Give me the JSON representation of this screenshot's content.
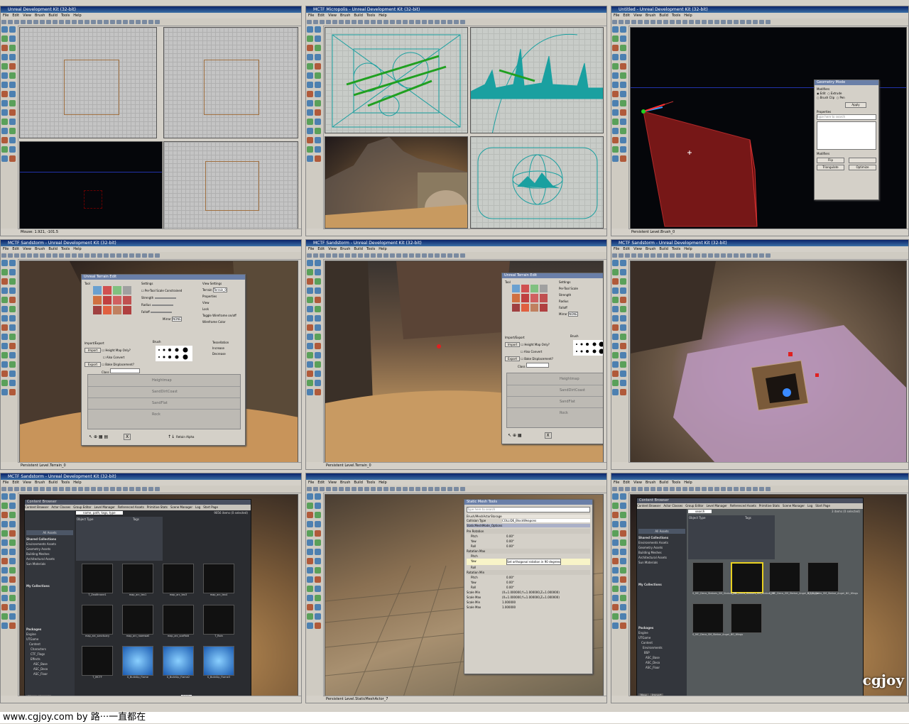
{
  "panels": [
    {
      "title": "Unreal Development Kit (32-bit)",
      "status": "Mouse: 1.921, -101.5"
    },
    {
      "title": "MCTF Micropolis - Unreal Development Kit (32-bit)",
      "status": ""
    },
    {
      "title": "Untitled - Unreal Development Kit (32-bit)",
      "status": "Persistent Level.Brush_0"
    },
    {
      "title": "MCTF Sandstorm - Unreal Development Kit (32-bit)",
      "status": "Persistent Level.Terrain_0"
    },
    {
      "title": "MCTF Sandstorm - Unreal Development Kit (32-bit)",
      "status": "Persistent Level.Terrain_0"
    },
    {
      "title": "MCTF Sandstorm - Unreal Development Kit (32-bit)",
      "status": ""
    },
    {
      "title": "MCTF Sandstorm - Unreal Development Kit (32-bit)",
      "status": ""
    },
    {
      "title": "",
      "status": "Persistent Level.StaticMeshActor_7"
    },
    {
      "title": "",
      "status": ""
    }
  ],
  "menu": [
    "File",
    "Edit",
    "View",
    "Brush",
    "Build",
    "Tools",
    "Help"
  ],
  "terrain_dialog": {
    "title": "Unreal Terrain Edit",
    "tool_label": "Tool",
    "settings_label": "Settings",
    "per_tool_scale": "Per-Tool Scale",
    "constrained": "Constrained",
    "strength": "Strength",
    "radius": "Radius",
    "falloff": "Falloff",
    "mirror": "Mirror",
    "mirror_value": "NONE",
    "view_settings": "View Settings",
    "terrain": "Terrain",
    "terrain_value": "Terrain_0",
    "properties": "Properties",
    "view": "View",
    "lock": "Lock",
    "toggle_wireframe": "Toggle Wireframe on/off",
    "wireframe_color": "Wireframe Color",
    "import_export": "Import/Export",
    "import_btn": "Import",
    "export_btn": "Export",
    "heightmap_only": "Height Map Only?",
    "retain_current": "Also Convert",
    "bake_displacement": "Bake Displacement?",
    "class_label": "Class",
    "brush_label": "Brush",
    "tessellation": "Tessellation",
    "increase": "Increase",
    "decrease": "Decrease",
    "layers": [
      "Heightmap",
      "SandDirtCoast",
      "SandFlat",
      "Rock"
    ],
    "retain_alpha": "Retain Alpha",
    "close_btn": "X"
  },
  "geometry_dialog": {
    "title": "Geometry Mode",
    "modifiers": "Modifiers",
    "edit": "Edit",
    "extrude": "Extrude",
    "brush_clip": "Brush Clip",
    "pen": "Pen",
    "apply": "Apply",
    "properties": "Properties",
    "search_placeholder": "type here to search",
    "flip": "Flip",
    "triangulate": "Triangulate",
    "optimize": "Optimize"
  },
  "content_browser": {
    "title": "Content Browser",
    "tabs": [
      "Content Browser",
      "Actor Classes",
      "Group Editor",
      "Level Manager",
      "Referenced Assets",
      "Primitive Stats",
      "Scene Manager",
      "Log",
      "Start Page"
    ],
    "search_value": "name, path, tags, type",
    "search_value2": "search",
    "all_assets": "All Assets",
    "shared_collections": "Shared Collections",
    "collections": [
      "Environments Assets",
      "Geometry Assets",
      "Building Meshes",
      "Architectural Assets",
      "Sun Materials"
    ],
    "my_collections": "My Collections",
    "packages": "Packages",
    "package_tree": [
      "Engine",
      "UTGame",
      "Content",
      "Characters",
      "CTF_Flags",
      "Effects",
      "Environments",
      "BSP",
      "ASC_Base",
      "ASC_Deco",
      "ASC_Floor",
      "ASC_Trim"
    ],
    "object_type": "Object Type",
    "tags": "Tags",
    "item_count": "9056 items (0 selected)",
    "item_count2": "3 items (0 selected)",
    "thumbs_type": "Texture2D",
    "thumbs_type2": "StaticMesh",
    "thumb_names": [
      "T_Zealthrone1",
      "map_arc_tex1",
      "map_arc_tex3",
      "map_arc_tex4",
      "map_arc_sanctuary",
      "map_arc_roomwall",
      "map_arc_scaffold",
      "T_Rain",
      "T_MCTF",
      "S_BuildUp_Flame",
      "S_BuildUp_Flame2",
      "S_BuildUp_Flame3"
    ],
    "mesh_names": [
      "S_MC_Deco_Statues_SM_Statue_HR",
      "S_MC_Deco_Statues_SM_Statue_HR",
      "S_MC_Deco_SM_Statue_Angel_BG_Angel",
      "S_MC_Deco_SM_Statue_Angel_BG_Wings",
      "S_MC_Deco_SM_Statue_Angel_BG_Wings"
    ],
    "new_btn": "New",
    "import_btn": "Import",
    "zoom": "100%"
  },
  "static_mesh_tools": {
    "title": "Static Mesh Tools",
    "search_placeholder": "Type here to search",
    "property_path": "Brush/MeshActorStorage",
    "collision_type": "Collision Type",
    "collision_value": "COLLIDE_BlockWeapons",
    "section": "StaticMeshMode_Options",
    "pre_rotation": "Pre Rotation",
    "rotation_max": "Rotation Max",
    "rotation_min": "Rotation Min",
    "pitch": "Pitch",
    "yaw": "Yaw",
    "roll": "Roll",
    "value0": "0.00°",
    "yaw_value": "Set orthogonal rotation in 90 degrees",
    "scale_min": "Scale Min",
    "scale_max": "Scale Max",
    "scale_value": "(X=1.000000,Y=1.000000,Z=1.000000)",
    "scale_one": "1.000000"
  },
  "caption": "www.cgjoy.com by 路···一直都在",
  "watermark": "cgjoy",
  "colors": {
    "titlebar": "#0a246a",
    "wire_cyan": "#1aa0a0",
    "wire_green": "#22aa22",
    "brush_red": "#c02020"
  }
}
